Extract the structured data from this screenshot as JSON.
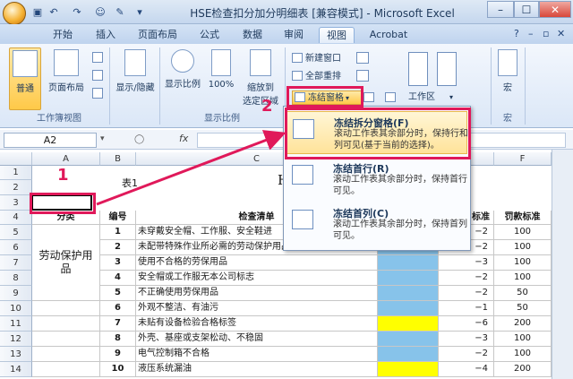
{
  "window": {
    "title": "HSE检查扣分加分明细表  [兼容模式] - Microsoft Excel",
    "min": "–",
    "max": "☐",
    "close": "✕"
  },
  "tabs": [
    "开始",
    "插入",
    "页面布局",
    "公式",
    "数据",
    "审阅",
    "视图",
    "Acrobat"
  ],
  "active_tab": "视图",
  "ribbon": {
    "workbook_views": {
      "label": "工作簿视图",
      "normal": "普通",
      "page_layout": "页面布局"
    },
    "show_hide": {
      "label": "显示/隐藏"
    },
    "zoom": {
      "label": "显示比例",
      "zoom": "显示比例",
      "hundred": "100%",
      "zoom_to_sel_line1": "缩放到",
      "zoom_to_sel_line2": "选定区域"
    },
    "window": {
      "new_window": "新建窗口",
      "arrange_all": "全部重排",
      "freeze_panes": "冻结窗格",
      "workspace": "工作区"
    },
    "macro": {
      "label": "宏",
      "macro": "宏"
    }
  },
  "name_box": "A2",
  "fx": "fx",
  "dropdown": {
    "items": [
      {
        "title": "冻结拆分窗格(F)",
        "desc": "滚动工作表其余部分时，保持行和列可见(基于当前的选择)。"
      },
      {
        "title": "冻结首行(R)",
        "desc": "滚动工作表其余部分时，保持首行可见。"
      },
      {
        "title": "冻结首列(C)",
        "desc": "滚动工作表其余部分时，保持首列可见。"
      }
    ]
  },
  "annotations": {
    "one": "1",
    "two": "2"
  },
  "sheet": {
    "columns": [
      "A",
      "B",
      "C",
      "D",
      "E",
      "F"
    ],
    "title_left": "表1",
    "title_mid": "HS",
    "header": {
      "category": "分类",
      "no": "编号",
      "item": "检查清单",
      "std": "标准",
      "fine": "罚款标准"
    },
    "group": "劳动保护用品",
    "rows": [
      {
        "r": "4",
        "no": "1",
        "item": "未穿戴安全帽、工作服、安全鞋进",
        "std": "−2",
        "fine": "100",
        "yellow": false
      },
      {
        "r": "5",
        "no": "2",
        "item": "未配带特殊作业所必需的劳动保护用品进行作业",
        "std": "−2",
        "fine": "100",
        "yellow": false
      },
      {
        "r": "6",
        "no": "3",
        "item": "使用不合格的劳保用品",
        "std": "−3",
        "fine": "100",
        "yellow": false
      },
      {
        "r": "7",
        "no": "4",
        "item": "安全帽或工作服无本公司标志",
        "std": "−2",
        "fine": "100",
        "yellow": false
      },
      {
        "r": "8",
        "no": "5",
        "item": "不正确使用劳保用品",
        "std": "−2",
        "fine": "50",
        "yellow": false
      },
      {
        "r": "9",
        "no": "6",
        "item": "外观不整洁、有油污",
        "std": "−1",
        "fine": "50",
        "yellow": false
      },
      {
        "r": "10",
        "no": "7",
        "item": "未贴有设备检验合格标签",
        "std": "−6",
        "fine": "200",
        "yellow": true
      },
      {
        "r": "11",
        "no": "8",
        "item": "外壳、基座或支架松动、不稳固",
        "std": "−3",
        "fine": "100",
        "yellow": false
      },
      {
        "r": "12",
        "no": "9",
        "item": "电气控制箱不合格",
        "std": "−2",
        "fine": "100",
        "yellow": false
      },
      {
        "r": "13",
        "no": "10",
        "item": "液压系统漏油",
        "std": "−4",
        "fine": "200",
        "yellow": true
      }
    ]
  }
}
